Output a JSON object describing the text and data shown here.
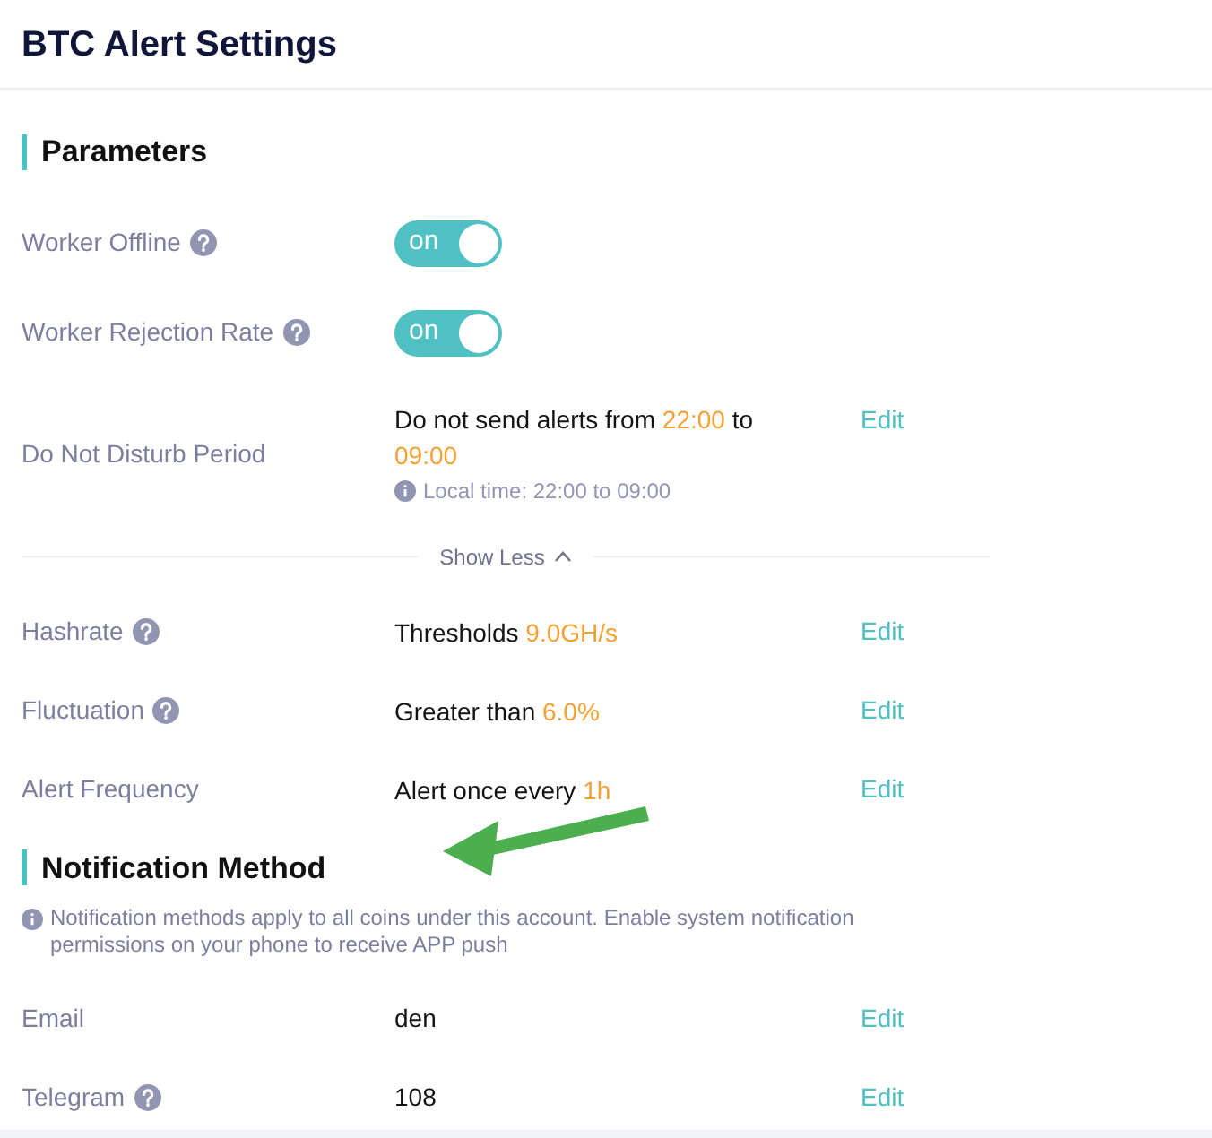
{
  "page": {
    "title": "BTC Alert Settings"
  },
  "sections": [
    {
      "title": "Parameters",
      "rows": [
        {
          "kind": "toggle",
          "label": "Worker Offline",
          "help": true,
          "toggle": {
            "text": "on",
            "on": true
          }
        },
        {
          "kind": "toggle",
          "label": "Worker Rejection Rate",
          "help": true,
          "toggle": {
            "text": "on",
            "on": true
          }
        },
        {
          "kind": "setting",
          "label": "Do Not Disturb Period",
          "help": false,
          "value": [
            {
              "text": "Do not send alerts from ",
              "highlight": false
            },
            {
              "text": "22:00",
              "highlight": true
            },
            {
              "text": " to ",
              "highlight": false
            },
            {
              "text": "09:00",
              "highlight": true
            }
          ],
          "note": "Local time: 22:00 to 09:00",
          "action": "Edit"
        },
        {
          "kind": "expander",
          "label": "Show Less",
          "expanded": true
        },
        {
          "kind": "setting",
          "label": "Hashrate",
          "help": true,
          "value": [
            {
              "text": "Thresholds ",
              "highlight": false
            },
            {
              "text": "9.0GH/s",
              "highlight": true
            }
          ],
          "action": "Edit"
        },
        {
          "kind": "setting",
          "label": "Fluctuation",
          "help": true,
          "value": [
            {
              "text": "Greater than ",
              "highlight": false
            },
            {
              "text": "6.0%",
              "highlight": true
            }
          ],
          "action": "Edit"
        },
        {
          "kind": "setting",
          "label": "Alert Frequency",
          "help": false,
          "value": [
            {
              "text": "Alert once every ",
              "highlight": false
            },
            {
              "text": "1h",
              "highlight": true
            }
          ],
          "action": "Edit"
        }
      ]
    },
    {
      "title": "Notification Method",
      "note": "Notification methods apply to all coins under this account. Enable system notification permissions on your phone to receive APP push",
      "rows": [
        {
          "kind": "setting",
          "label": "Email",
          "help": false,
          "value": [
            {
              "text": "den",
              "highlight": false
            }
          ],
          "action": "Edit"
        },
        {
          "kind": "setting",
          "label": "Telegram",
          "help": true,
          "value": [
            {
              "text": "108",
              "highlight": false
            }
          ],
          "action": "Edit"
        }
      ]
    }
  ]
}
